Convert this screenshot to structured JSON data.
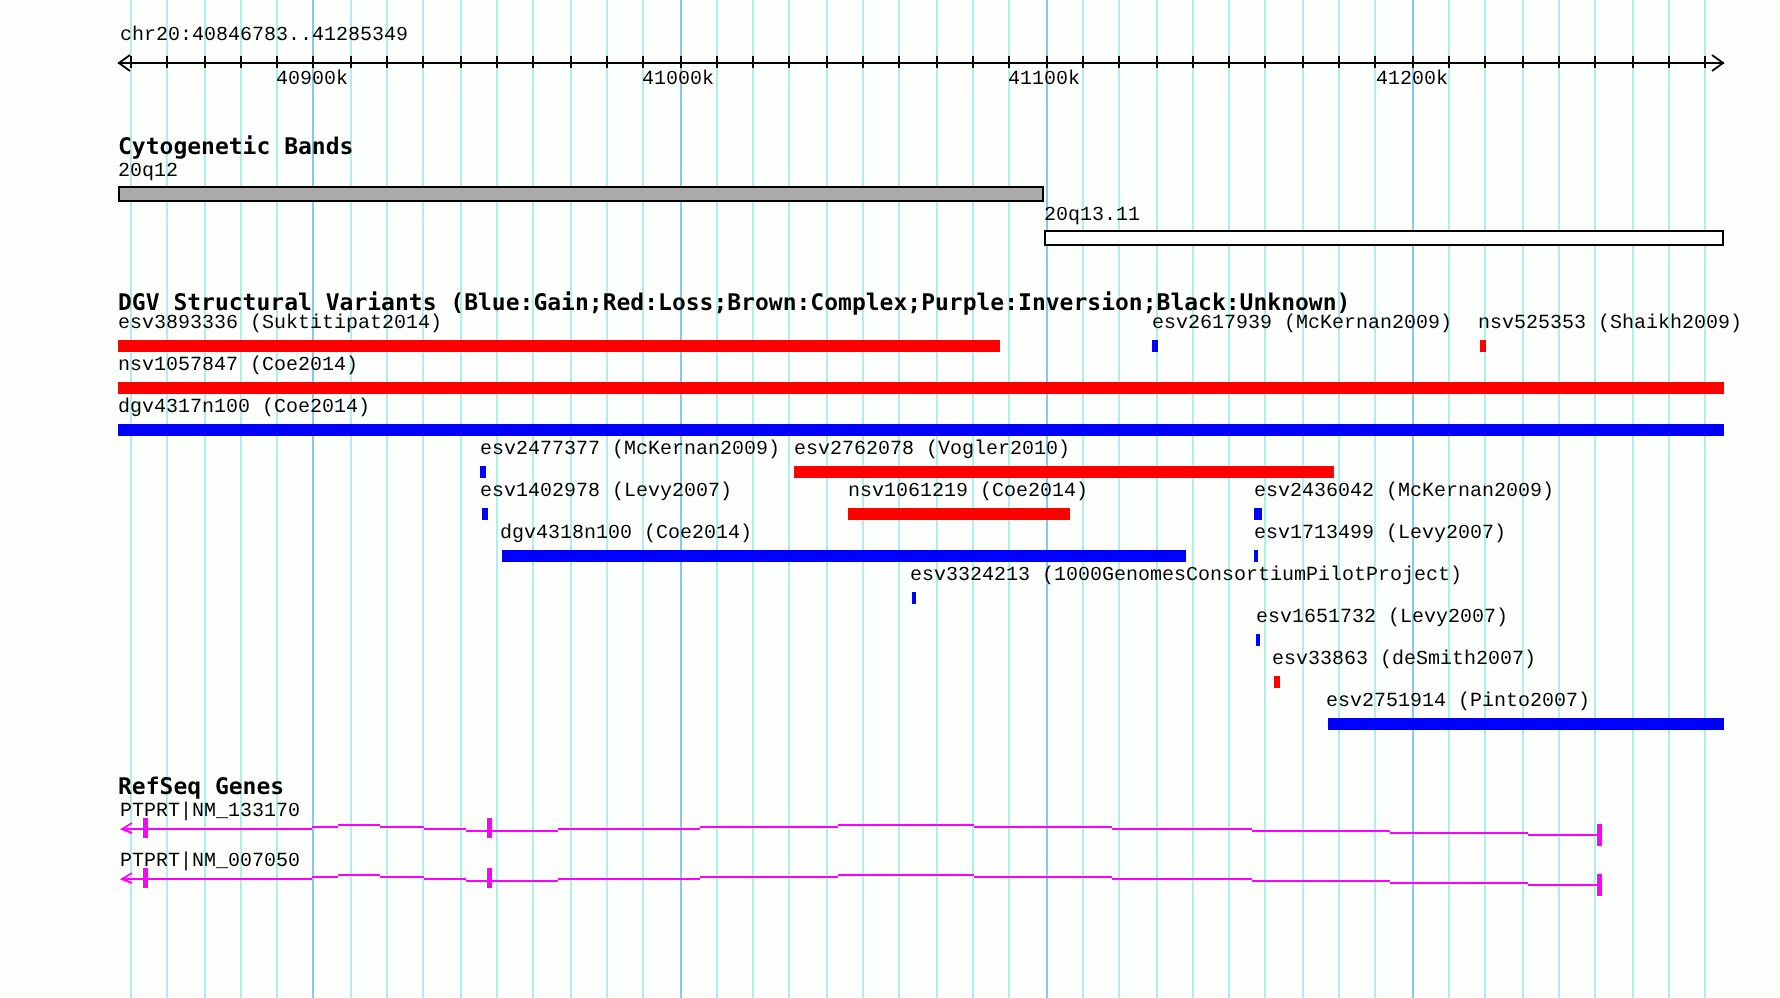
{
  "ruler": {
    "location": "chr20:40846783..41285349",
    "ticks": [
      "40900k",
      "41000k",
      "41100k",
      "41200k"
    ]
  },
  "cytogenetic_bands": {
    "title": "Cytogenetic Bands",
    "bands": [
      {
        "name": "20q12",
        "color": "#aaaaaa"
      },
      {
        "name": "20q13.11",
        "color": "#ffffff"
      }
    ]
  },
  "structural_variants": {
    "title": "DGV Structural Variants (Blue:Gain;Red:Loss;Brown:Complex;Purple:Inversion;Black:Unknown)",
    "variants": [
      {
        "name": "esv3893336 (Suktitipat2014)",
        "color": "#ff0000"
      },
      {
        "name": "esv2617939 (McKernan2009)",
        "color": "#0000ff"
      },
      {
        "name": "nsv525353 (Shaikh2009)",
        "color": "#ff0000"
      },
      {
        "name": "nsv1057847 (Coe2014)",
        "color": "#ff0000"
      },
      {
        "name": "dgv4317n100 (Coe2014)",
        "color": "#0000ff"
      },
      {
        "name": "esv2477377 (McKernan2009)",
        "color": "#0000ff"
      },
      {
        "name": "esv2762078 (Vogler2010)",
        "color": "#ff0000"
      },
      {
        "name": "esv1402978 (Levy2007)",
        "color": "#0000ff"
      },
      {
        "name": "nsv1061219 (Coe2014)",
        "color": "#ff0000"
      },
      {
        "name": "esv2436042 (McKernan2009)",
        "color": "#0000ff"
      },
      {
        "name": "dgv4318n100 (Coe2014)",
        "color": "#0000ff"
      },
      {
        "name": "esv1713499 (Levy2007)",
        "color": "#0000ff"
      },
      {
        "name": "esv3324213 (1000GenomesConsortiumPilotProject)",
        "color": "#0000ff"
      },
      {
        "name": "esv1651732 (Levy2007)",
        "color": "#0000ff"
      },
      {
        "name": "esv33863 (deSmith2007)",
        "color": "#ff0000"
      },
      {
        "name": "esv2751914 (Pinto2007)",
        "color": "#0000ff"
      }
    ]
  },
  "refseq_genes": {
    "title": "RefSeq Genes",
    "genes": [
      "PTPRT|NM_133170",
      "PTPRT|NM_007050"
    ]
  }
}
